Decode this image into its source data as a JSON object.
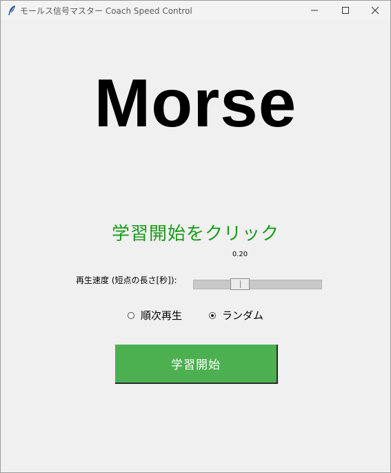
{
  "window": {
    "title": "モールス信号マスター Coach Speed Control",
    "app_icon": "feather-icon",
    "controls": {
      "minimize_icon": "minimize-icon",
      "maximize_icon": "maximize-icon",
      "close_icon": "close-icon"
    }
  },
  "main": {
    "display_text": "Morse",
    "status_text": "学習開始をクリック",
    "speed": {
      "label": "再生速度 (短点の長さ[秒]):",
      "value": "0.20",
      "level_fraction": 0.35
    },
    "play_mode": {
      "options": [
        {
          "label": "順次再生",
          "selected": false
        },
        {
          "label": "ランダム",
          "selected": true
        }
      ]
    },
    "start_button_label": "学習開始"
  },
  "colors": {
    "status_text": "#1a9a1a",
    "start_button": "#4caf50",
    "start_button_text": "#ffffff",
    "background": "#f0f0f0"
  }
}
